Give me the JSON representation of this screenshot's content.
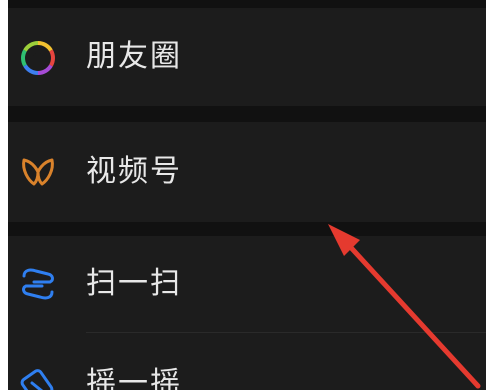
{
  "menu": {
    "items": [
      {
        "label": "朋友圈",
        "icon": "moments-icon"
      },
      {
        "label": "视频号",
        "icon": "channels-icon"
      },
      {
        "label": "扫一扫",
        "icon": "scan-icon"
      },
      {
        "label": "摇一摇",
        "icon": "shake-icon"
      }
    ]
  },
  "colors": {
    "background": "#111111",
    "row": "#1c1c1c",
    "text": "#e8e8e8",
    "channels_accent": "#d9822b",
    "scan_accent": "#2f7ff0",
    "annotation_arrow": "#e53a2f"
  }
}
